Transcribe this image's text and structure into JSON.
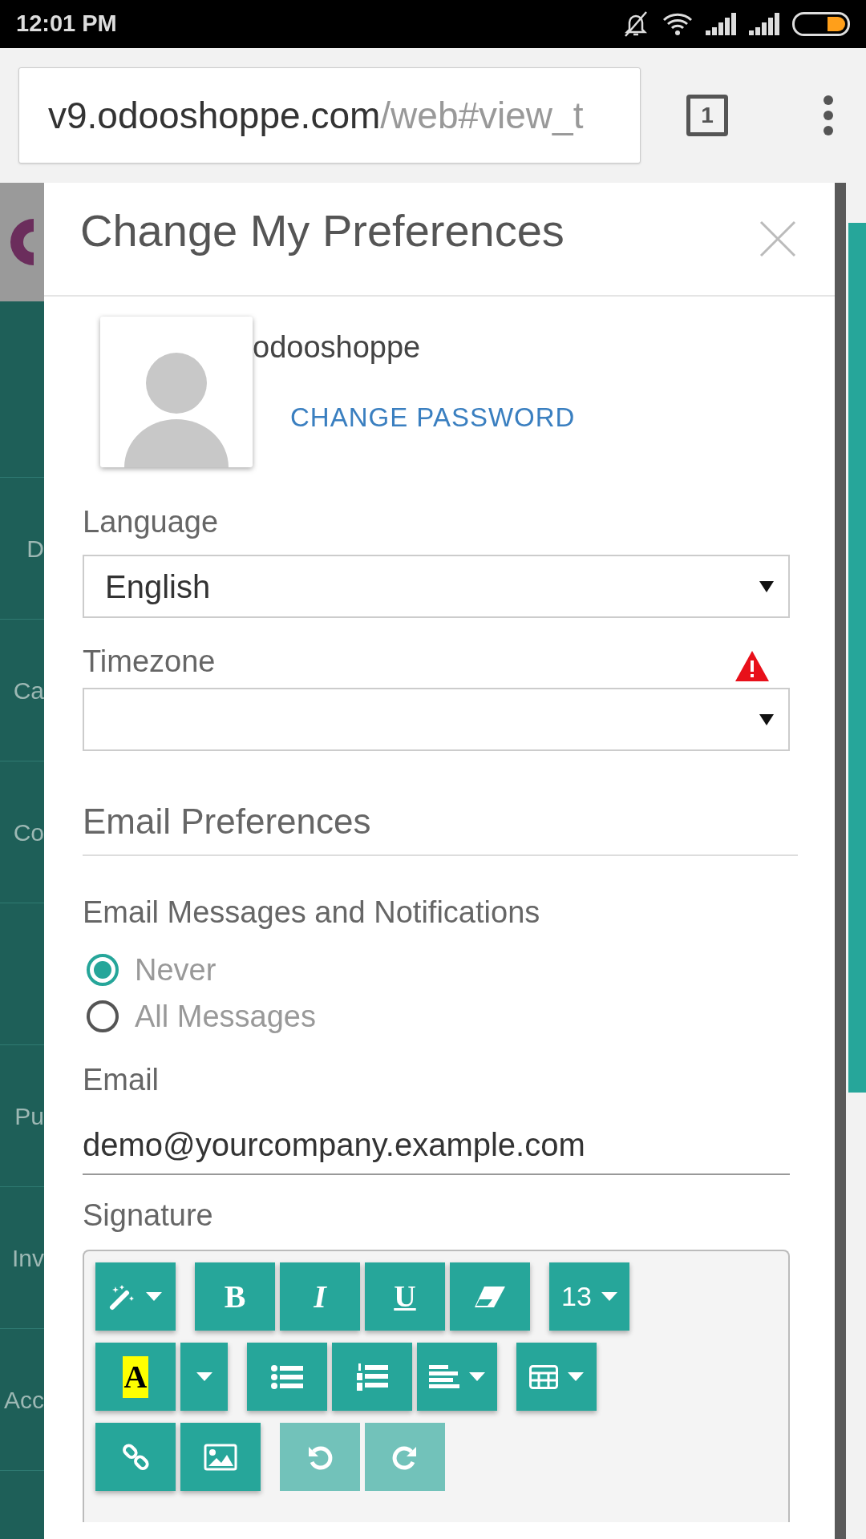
{
  "status_bar": {
    "time": "12:01 PM"
  },
  "browser": {
    "url_host": "v9.odooshoppe.com",
    "url_path": "/web#view_t",
    "tab_count": "1"
  },
  "background": {
    "sidebar_groups": [
      [
        "D",
        "Ca",
        "Co"
      ],
      [
        "Pu",
        "Inv",
        "Acc"
      ]
    ]
  },
  "dialog": {
    "title": "Change My Preferences",
    "user": {
      "name": "odooshoppe",
      "change_password": "CHANGE PASSWORD"
    },
    "language": {
      "label": "Language",
      "value": "English"
    },
    "timezone": {
      "label": "Timezone",
      "warning": true
    },
    "email_preferences": {
      "heading": "Email Preferences",
      "label": "Email Messages and Notifications",
      "options": [
        {
          "label": "Never",
          "selected": true
        },
        {
          "label": "All Messages",
          "selected": false
        }
      ]
    },
    "email": {
      "label": "Email",
      "value": "demo@yourcompany.example.com"
    },
    "signature": {
      "label": "Signature",
      "toolbar": [
        [
          [
            {
              "kind": "wand",
              "caret": true,
              "disabled": false
            }
          ],
          [
            {
              "kind": "bold",
              "label": "B",
              "caret": false,
              "disabled": false
            },
            {
              "kind": "italic",
              "label": "I",
              "caret": false,
              "disabled": false
            },
            {
              "kind": "underline",
              "label": "U",
              "caret": false,
              "disabled": false
            },
            {
              "kind": "eraser",
              "caret": false,
              "disabled": false
            }
          ],
          [
            {
              "kind": "size",
              "label": "13",
              "caret": true,
              "disabled": false
            }
          ]
        ],
        [
          [
            {
              "kind": "highlight",
              "label": "A",
              "caret": false,
              "disabled": false
            },
            {
              "kind": "dropdown",
              "caret": true,
              "disabled": false
            }
          ],
          [
            {
              "kind": "bullets",
              "caret": false,
              "disabled": false
            },
            {
              "kind": "numbers",
              "caret": false,
              "disabled": false
            },
            {
              "kind": "align",
              "caret": true,
              "disabled": false
            }
          ],
          [
            {
              "kind": "table",
              "caret": true,
              "disabled": false
            }
          ]
        ],
        [
          [
            {
              "kind": "link",
              "caret": false,
              "disabled": false
            },
            {
              "kind": "image",
              "caret": false,
              "disabled": false
            }
          ],
          [
            {
              "kind": "undo",
              "caret": false,
              "disabled": true
            },
            {
              "kind": "redo",
              "caret": false,
              "disabled": true
            }
          ]
        ]
      ]
    }
  }
}
